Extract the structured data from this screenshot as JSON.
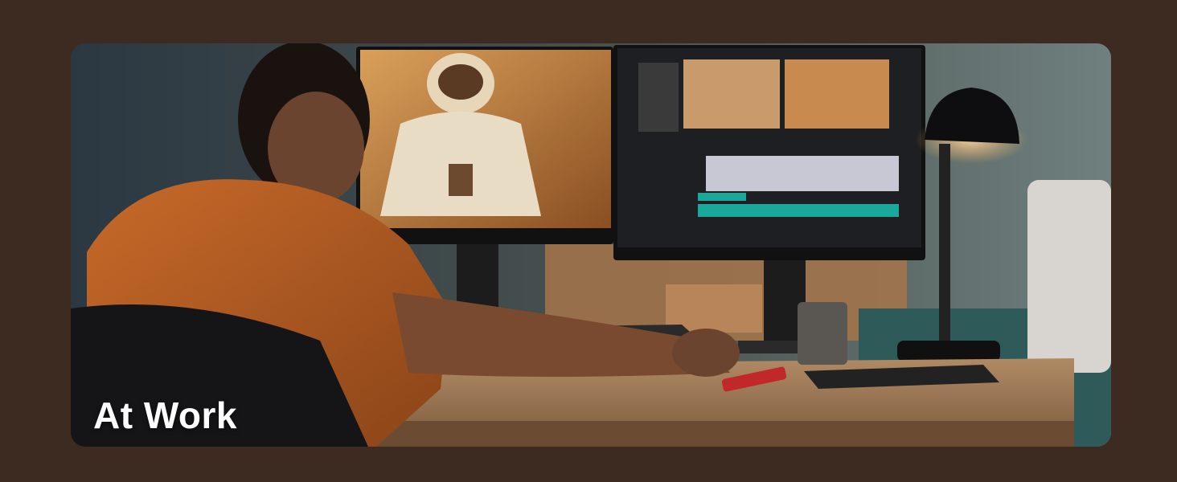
{
  "banner": {
    "caption": "At Work"
  }
}
